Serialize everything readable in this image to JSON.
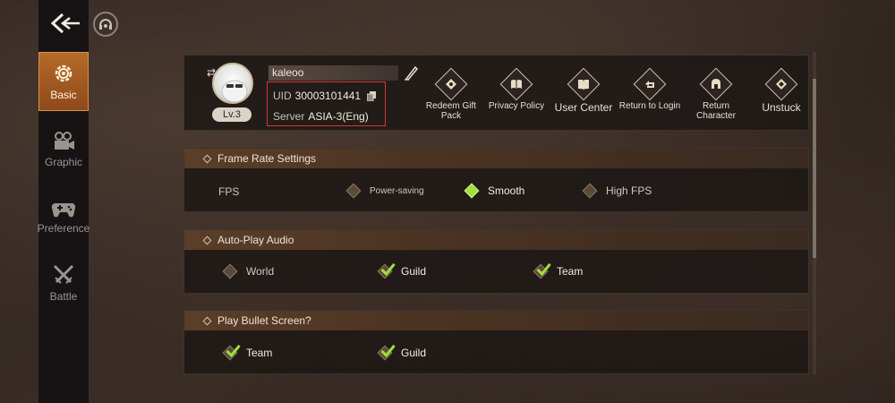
{
  "sidebar": {
    "items": [
      {
        "label": "Basic",
        "icon": "settings-gear-icon",
        "active": true
      },
      {
        "label": "Graphic",
        "icon": "camera-icon",
        "active": false
      },
      {
        "label": "Preference",
        "icon": "gamepad-icon",
        "active": false
      },
      {
        "label": "Battle",
        "icon": "crossed-swords-icon",
        "active": false
      }
    ]
  },
  "profile": {
    "name": "kaleoo",
    "level": "Lv.3",
    "uid_label": "UID",
    "uid": "30003101441",
    "server_label": "Server",
    "server": "ASIA-3(Eng)"
  },
  "actions": [
    {
      "label": "Redeem Gift Pack",
      "icon": "gift-icon"
    },
    {
      "label": "Privacy Policy",
      "icon": "book-icon"
    },
    {
      "label": "User Center",
      "icon": "book-open-icon"
    },
    {
      "label": "Return to Login",
      "icon": "return-arrow-icon"
    },
    {
      "label": "Return Character",
      "icon": "helmet-icon"
    },
    {
      "label": "Unstuck",
      "icon": "unstuck-icon"
    }
  ],
  "sections": {
    "frame_rate": {
      "title": "Frame Rate Settings",
      "row_label": "FPS",
      "options": [
        {
          "label": "Power-saving",
          "selected": false
        },
        {
          "label": "Smooth",
          "selected": true
        },
        {
          "label": "High FPS",
          "selected": false
        }
      ]
    },
    "auto_play_audio": {
      "title": "Auto-Play Audio",
      "options": [
        {
          "label": "World",
          "checked": false
        },
        {
          "label": "Guild",
          "checked": true
        },
        {
          "label": "Team",
          "checked": true
        }
      ]
    },
    "bullet_screen": {
      "title": "Play Bullet Screen?",
      "options": [
        {
          "label": "Team",
          "checked": true
        },
        {
          "label": "Guild",
          "checked": true
        }
      ]
    }
  },
  "colors": {
    "accent_active": "#b56a2a",
    "selected_green": "#9fe03a",
    "highlight_red": "#d8353a"
  }
}
